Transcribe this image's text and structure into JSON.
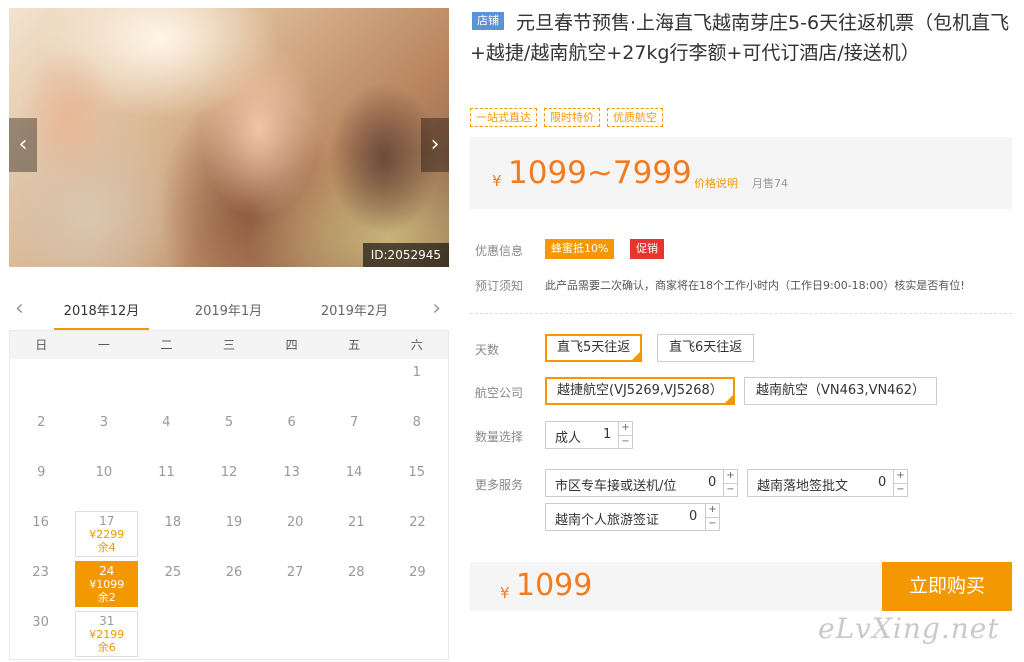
{
  "photo": {
    "prev_icon": "chevron-left",
    "next_icon": "chevron-right",
    "id_label": "ID:2052945"
  },
  "calendar": {
    "prev_icon": "chevron-left",
    "next_icon": "chevron-right",
    "months": [
      "2018年12月",
      "2019年1月",
      "2019年2月"
    ],
    "active_month": "2018年12月",
    "weekdays": [
      "日",
      "一",
      "二",
      "三",
      "四",
      "五",
      "六"
    ],
    "weeks": [
      [
        {
          "d": ""
        },
        {
          "d": ""
        },
        {
          "d": ""
        },
        {
          "d": ""
        },
        {
          "d": ""
        },
        {
          "d": ""
        },
        {
          "d": "1"
        }
      ],
      [
        {
          "d": "2"
        },
        {
          "d": "3"
        },
        {
          "d": "4"
        },
        {
          "d": "5"
        },
        {
          "d": "6"
        },
        {
          "d": "7"
        },
        {
          "d": "8"
        }
      ],
      [
        {
          "d": "9"
        },
        {
          "d": "10"
        },
        {
          "d": "11"
        },
        {
          "d": "12"
        },
        {
          "d": "13"
        },
        {
          "d": "14"
        },
        {
          "d": "15"
        }
      ],
      [
        {
          "d": "16"
        },
        {
          "d": "17",
          "price": "¥2299",
          "remain": "余4"
        },
        {
          "d": "18"
        },
        {
          "d": "19"
        },
        {
          "d": "20"
        },
        {
          "d": "21"
        },
        {
          "d": "22"
        }
      ],
      [
        {
          "d": "23"
        },
        {
          "d": "24",
          "price": "¥1099",
          "remain": "余2",
          "selected": true
        },
        {
          "d": "25"
        },
        {
          "d": "26"
        },
        {
          "d": "27"
        },
        {
          "d": "28"
        },
        {
          "d": "29"
        }
      ],
      [
        {
          "d": "30"
        },
        {
          "d": "31",
          "price": "¥2199",
          "remain": "余6"
        },
        {
          "d": ""
        },
        {
          "d": ""
        },
        {
          "d": ""
        },
        {
          "d": ""
        },
        {
          "d": ""
        }
      ]
    ]
  },
  "product": {
    "shop_badge": "店铺",
    "title": "元旦春节预售·上海直飞越南芽庄5-6天往返机票（包机直飞+越捷/越南航空+27kg行李额+可代订酒店/接送机）",
    "tags": [
      "一站式直达",
      "限时特价",
      "优质航空"
    ],
    "currency": "¥",
    "price_range": "1099~7999",
    "price_note": "价格说明",
    "monthly_sales": "月售74"
  },
  "promo": {
    "label": "优惠信息",
    "badge1": "蜂蜜抵10%",
    "badge2": "促销"
  },
  "booking_notice": {
    "label": "预订须知",
    "text": "此产品需要二次确认，商家将在18个工作小时内（工作日9:00-18:00）核实是否有位!"
  },
  "options": {
    "days": {
      "label": "天数",
      "choices": [
        "直飞5天往返",
        "直飞6天往返"
      ],
      "selected": "直飞5天往返"
    },
    "airline": {
      "label": "航空公司",
      "choices": [
        "越捷航空(VJ5269,VJ5268）",
        "越南航空（VN463,VN462）"
      ],
      "selected": "越捷航空(VJ5269,VJ5268）"
    },
    "quantity": {
      "label": "数量选择",
      "item": "成人",
      "value": "1"
    },
    "services": {
      "label": "更多服务",
      "items": [
        {
          "name": "市区专车接或送机/位",
          "value": "0"
        },
        {
          "name": "越南落地签批文",
          "value": "0"
        },
        {
          "name": "越南个人旅游签证",
          "value": "0"
        }
      ]
    }
  },
  "checkout": {
    "currency": "¥",
    "total": "1099",
    "buy_label": "立即购买"
  },
  "watermark": "eLvXing.net",
  "colors": {
    "accent": "#f39800",
    "price": "#f37b1d",
    "promo_red": "#e8332e",
    "shop_badge": "#5c93d6"
  }
}
